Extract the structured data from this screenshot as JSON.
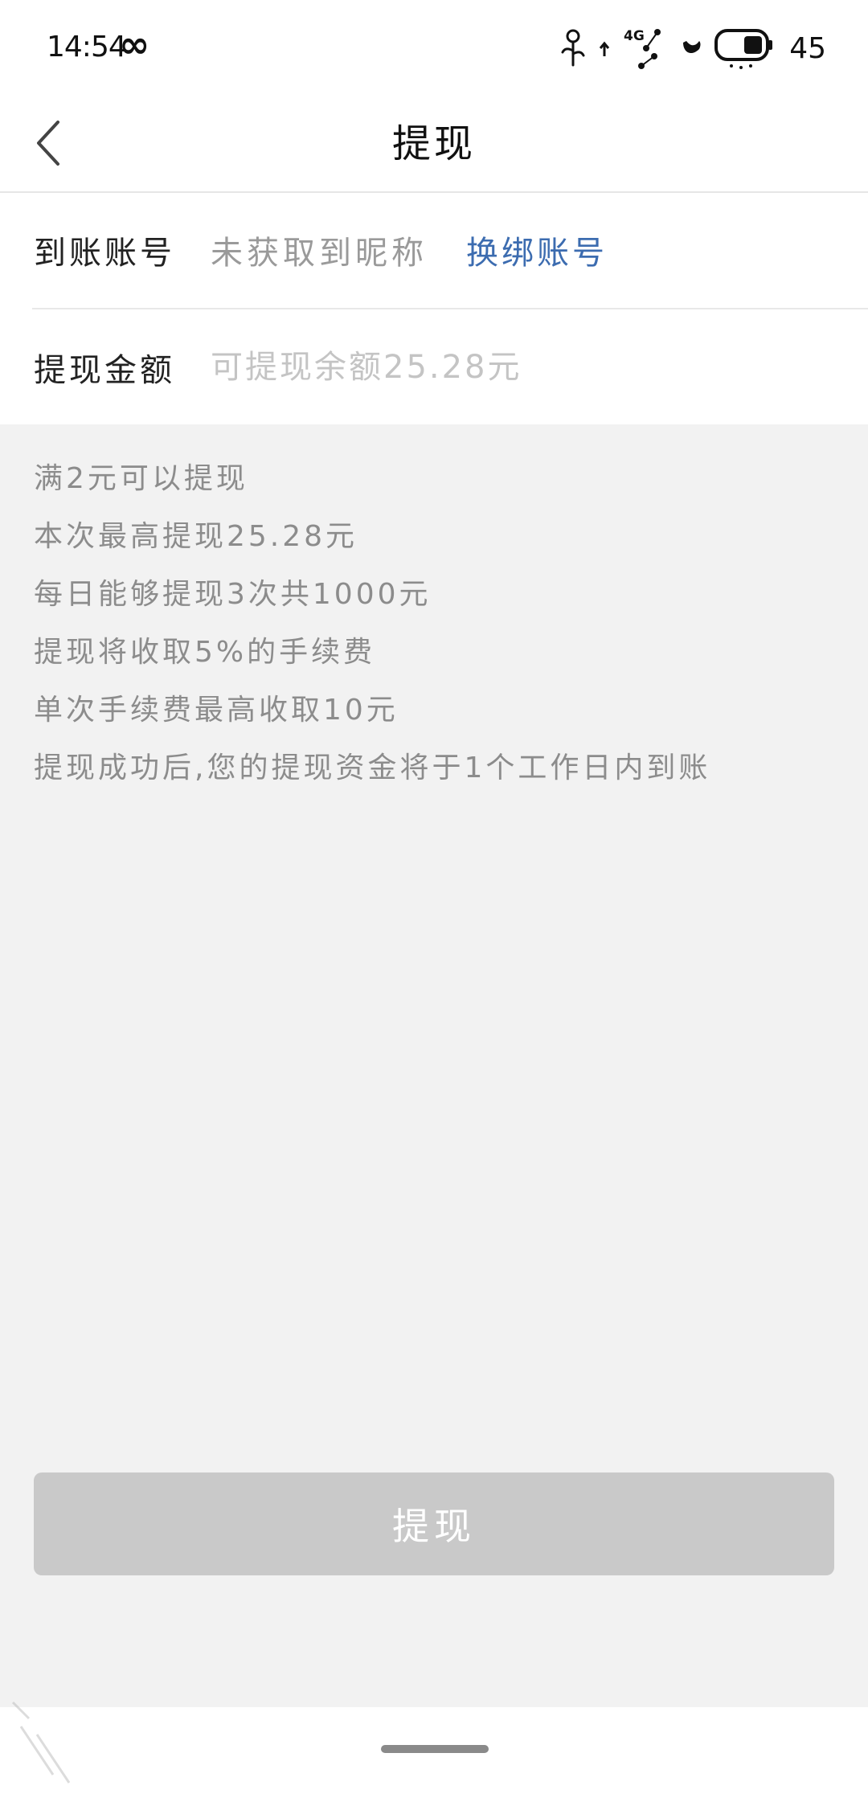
{
  "status_bar": {
    "time": "14:54",
    "infinity_glyph": "∞",
    "network": "4G",
    "battery_level": "45",
    "icons": [
      "flower-icon",
      "upload-arrow-icon",
      "4g-signal-icon",
      "paw-icon",
      "battery-icon"
    ]
  },
  "header": {
    "title": "提现",
    "back_icon": "chevron-left-icon"
  },
  "form": {
    "account": {
      "label": "到账账号",
      "value": "未获取到昵称",
      "change_label": "换绑账号"
    },
    "amount": {
      "label": "提现金额",
      "placeholder": "可提现余额25.28元",
      "value": ""
    }
  },
  "notes": [
    "满2元可以提现",
    "本次最高提现25.28元",
    "每日能够提现3次共1000元",
    "提现将收取5%的手续费",
    "单次手续费最高收取10元",
    "提现成功后,您的提现资金将于1个工作日内到账"
  ],
  "actions": {
    "withdraw_label": "提现"
  },
  "colors": {
    "link_blue": "#3c6cb0",
    "button_disabled": "#c9c9c9",
    "page_background": "#f2f2f2"
  }
}
